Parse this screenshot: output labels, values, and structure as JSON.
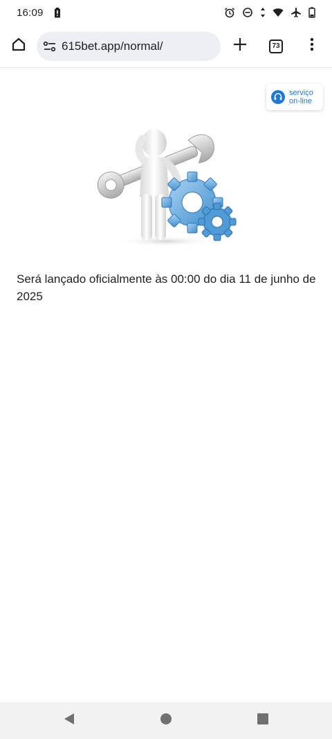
{
  "status_bar": {
    "time": "16:09",
    "icons": [
      "battery-saver-icon",
      "alarm-icon",
      "do-not-disturb-icon",
      "data-arrows-icon",
      "wifi-icon",
      "airplane-icon",
      "battery-icon"
    ]
  },
  "browser": {
    "url": "615bet.app/normal/",
    "tab_count": "73",
    "icons": [
      "home-icon",
      "site-settings-icon",
      "new-tab-icon",
      "tab-switcher-icon",
      "more-vert-icon"
    ]
  },
  "page": {
    "service_line1": "serviço",
    "service_line2": "on-line",
    "message": "Será lançado oficialmente às 00:00 do dia 11 de junho de 2025",
    "accent_color": "#1e78d8"
  },
  "navigation": {
    "icons": [
      "back-icon",
      "home-circle-icon",
      "recents-icon"
    ]
  }
}
